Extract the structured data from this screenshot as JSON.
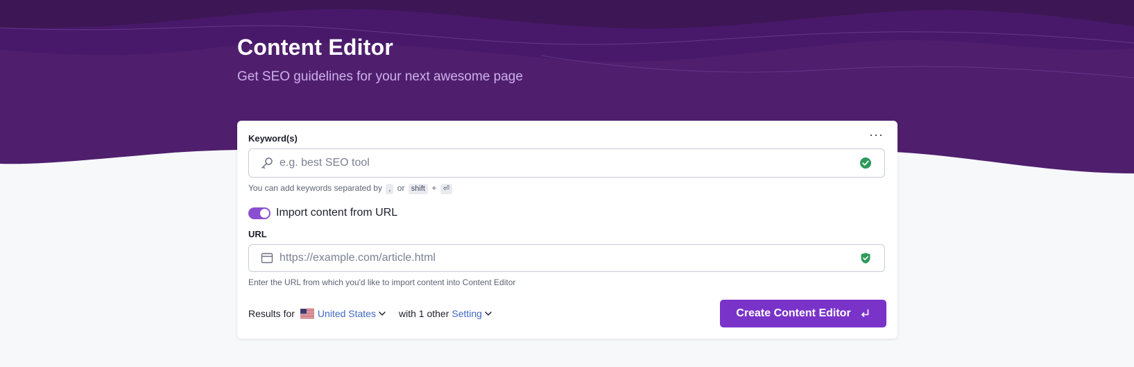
{
  "header": {
    "title": "Content Editor",
    "subtitle": "Get SEO guidelines for your next awesome page"
  },
  "form": {
    "more_label": "···",
    "keywords": {
      "label": "Keyword(s)",
      "placeholder": "e.g. best SEO tool",
      "hint_prefix": "You can add keywords separated by",
      "hint_key_comma": ",",
      "hint_or": "or",
      "hint_key_shift": "shift",
      "hint_plus": "+",
      "hint_key_enter": "⏎"
    },
    "import_toggle": {
      "label": "Import content from URL",
      "enabled": true
    },
    "url": {
      "label": "URL",
      "placeholder": "https://example.com/article.html",
      "hint": "Enter the URL from which you'd like to import content into Content Editor"
    },
    "results": {
      "prefix": "Results for",
      "country": "United States",
      "with_text": "with 1 other",
      "setting_link": "Setting"
    },
    "submit_label": "Create Content Editor"
  },
  "colors": {
    "brand_purple": "#7a33c9",
    "hero_dark": "#3c1752",
    "hero_mid": "#4f1f6e",
    "success_green": "#2e9a5a",
    "link_blue": "#3f67c4"
  },
  "icons": {
    "keyword_lead": "key-icon",
    "url_lead": "browser-window-icon",
    "valid": "check-circle-icon",
    "enter": "enter-key-icon",
    "chevron": "chevron-down-icon",
    "flag": "us-flag-icon"
  }
}
